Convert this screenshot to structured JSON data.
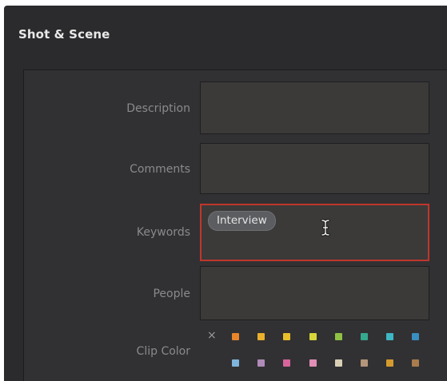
{
  "panel": {
    "title": "Shot & Scene"
  },
  "fields": {
    "description": {
      "label": "Description",
      "value": ""
    },
    "comments": {
      "label": "Comments",
      "value": ""
    },
    "keywords": {
      "label": "Keywords",
      "tags": [
        "Interview"
      ]
    },
    "people": {
      "label": "People",
      "value": ""
    }
  },
  "clip_color": {
    "label": "Clip Color",
    "clear_symbol": "×",
    "row1": [
      "#e8862b",
      "#e9b12c",
      "#e9c02b",
      "#d7d63a",
      "#8ec144",
      "#36a98f",
      "#3db7c4",
      "#3a8ec1"
    ],
    "row2": [
      "#7fb5dd",
      "#b08bb8",
      "#d8649c",
      "#e28fb7",
      "#d9cfb5",
      "#b5967a",
      "#d39b2e",
      "#a97c4d"
    ]
  },
  "colors": {
    "panel_bg": "#2b2b2d",
    "body_bg": "#313133",
    "field_bg": "#3b3a39",
    "active_border": "#c0362c"
  }
}
